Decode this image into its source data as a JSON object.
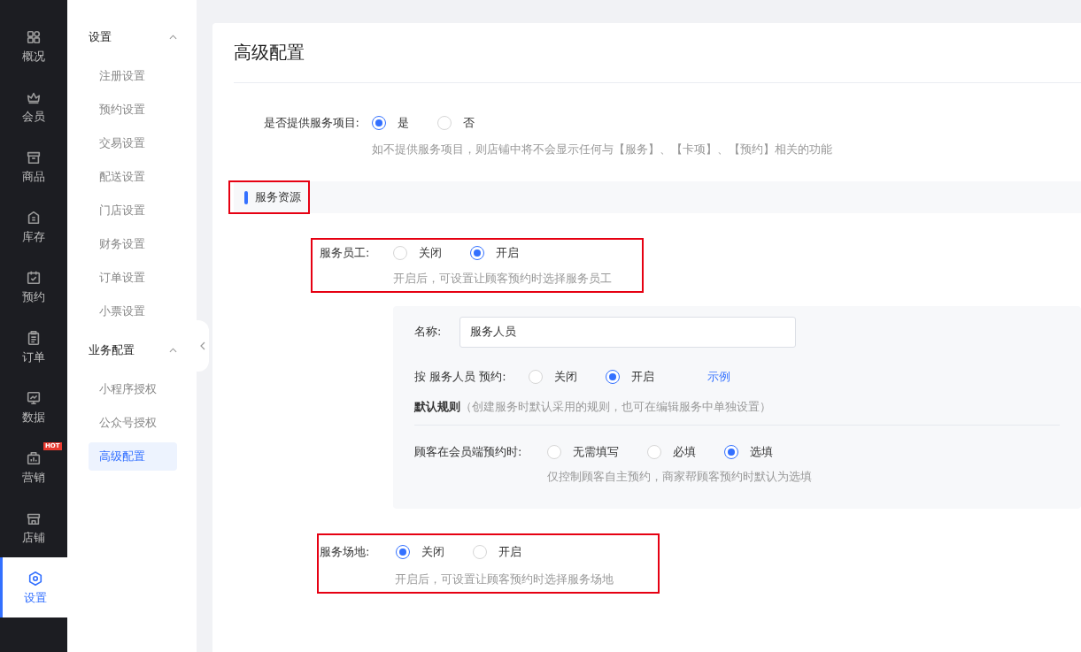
{
  "nav": [
    {
      "label": "概况",
      "kind": "grid",
      "selected": false
    },
    {
      "label": "会员",
      "kind": "crown",
      "selected": false
    },
    {
      "label": "商品",
      "kind": "box",
      "selected": false
    },
    {
      "label": "库存",
      "kind": "stock",
      "selected": false
    },
    {
      "label": "预约",
      "kind": "calendar",
      "selected": false
    },
    {
      "label": "订单",
      "kind": "clipboard",
      "selected": false
    },
    {
      "label": "数据",
      "kind": "chart",
      "selected": false
    },
    {
      "label": "营销",
      "kind": "bag",
      "selected": false,
      "badge": "HOT"
    },
    {
      "label": "店铺",
      "kind": "shop",
      "selected": false
    },
    {
      "label": "设置",
      "kind": "gear",
      "selected": true
    }
  ],
  "subnav": [
    {
      "title": "设置",
      "expanded": true,
      "items": [
        {
          "label": "注册设置",
          "selected": false
        },
        {
          "label": "预约设置",
          "selected": false
        },
        {
          "label": "交易设置",
          "selected": false
        },
        {
          "label": "配送设置",
          "selected": false
        },
        {
          "label": "门店设置",
          "selected": false
        },
        {
          "label": "财务设置",
          "selected": false
        },
        {
          "label": "订单设置",
          "selected": false
        },
        {
          "label": "小票设置",
          "selected": false
        }
      ]
    },
    {
      "title": "业务配置",
      "expanded": true,
      "items": [
        {
          "label": "小程序授权",
          "selected": false
        },
        {
          "label": "公众号授权",
          "selected": false
        },
        {
          "label": "高级配置",
          "selected": true
        }
      ]
    }
  ],
  "page": {
    "title": "高级配置",
    "provide_service": {
      "label": "是否提供服务项目:",
      "options": [
        {
          "label": "是",
          "selected": true
        },
        {
          "label": "否",
          "selected": false
        }
      ],
      "hint": "如不提供服务项目，则店铺中将不会显示任何与【服务】、【卡项】、【预约】相关的功能"
    },
    "section": {
      "title": "服务资源",
      "highlighted": true
    },
    "staff": {
      "label": "服务员工:",
      "highlighted": true,
      "options": [
        {
          "label": "关闭",
          "selected": false
        },
        {
          "label": "开启",
          "selected": true
        }
      ],
      "hint": "开启后，可设置让顾客预约时选择服务员工",
      "panel": {
        "name_label": "名称:",
        "name_value": "服务人员",
        "by_label": "按 服务人员 预约:",
        "by_options": [
          {
            "label": "关闭",
            "selected": false
          },
          {
            "label": "开启",
            "selected": true
          }
        ],
        "example_link": "示例",
        "rule_title": "默认规则",
        "rule_note": "（创建服务时默认采用的规则，也可在编辑服务中单独设置）",
        "customer_label": "顾客在会员端预约时:",
        "customer_options": [
          {
            "label": "无需填写",
            "selected": false
          },
          {
            "label": "必填",
            "selected": false
          },
          {
            "label": "选填",
            "selected": true
          }
        ],
        "customer_hint": "仅控制顾客自主预约，商家帮顾客预约时默认为选填"
      }
    },
    "venue": {
      "label": "服务场地:",
      "highlighted": true,
      "options": [
        {
          "label": "关闭",
          "selected": true
        },
        {
          "label": "开启",
          "selected": false
        }
      ],
      "hint": "开启后，可设置让顾客预约时选择服务场地"
    }
  }
}
